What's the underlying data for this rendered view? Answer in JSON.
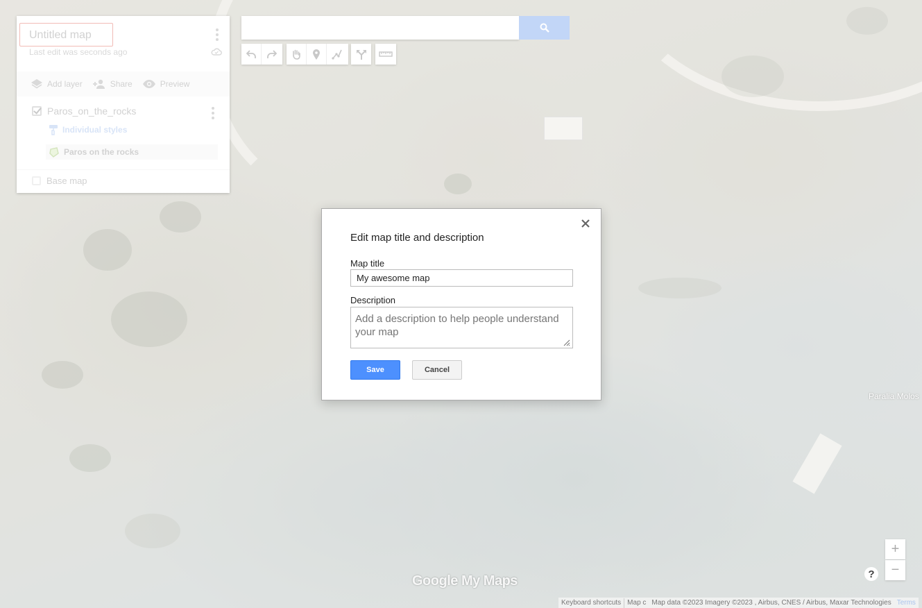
{
  "map": {
    "place_label": "Paralia Molos",
    "brand": "Google My Maps"
  },
  "panel": {
    "title": "Untitled map",
    "last_edit": "Last edit was seconds ago",
    "actions": {
      "add_layer": "Add layer",
      "share": "Share",
      "preview": "Preview"
    },
    "layer": {
      "name": "Paros_on_the_rocks",
      "checked": true,
      "style": "Individual styles",
      "feature": "Paros on the rocks"
    },
    "base_map": "Base map"
  },
  "search": {
    "value": ""
  },
  "toolbar": {
    "icons": [
      "undo-icon",
      "redo-icon",
      "hand-icon",
      "marker-icon",
      "line-icon",
      "directions-icon",
      "ruler-icon"
    ]
  },
  "dialog": {
    "title": "Edit map title and description",
    "title_label": "Map title",
    "title_value": "My awesome map",
    "description_label": "Description",
    "description_placeholder": "Add a description to help people understand your map",
    "save": "Save",
    "cancel": "Cancel"
  },
  "controls": {
    "zoom_in": "+",
    "zoom_out": "−",
    "help": "?"
  },
  "footer": {
    "keyboard_shortcuts": "Keyboard shortcuts",
    "map_data_short": "Map c",
    "map_data": "Map data ©2023 Imagery ©2023 , Airbus, CNES / Airbus, Maxar Technologies",
    "terms": "Terms"
  },
  "colors": {
    "accent": "#4d90fe",
    "title_outline": "#e0695e"
  }
}
